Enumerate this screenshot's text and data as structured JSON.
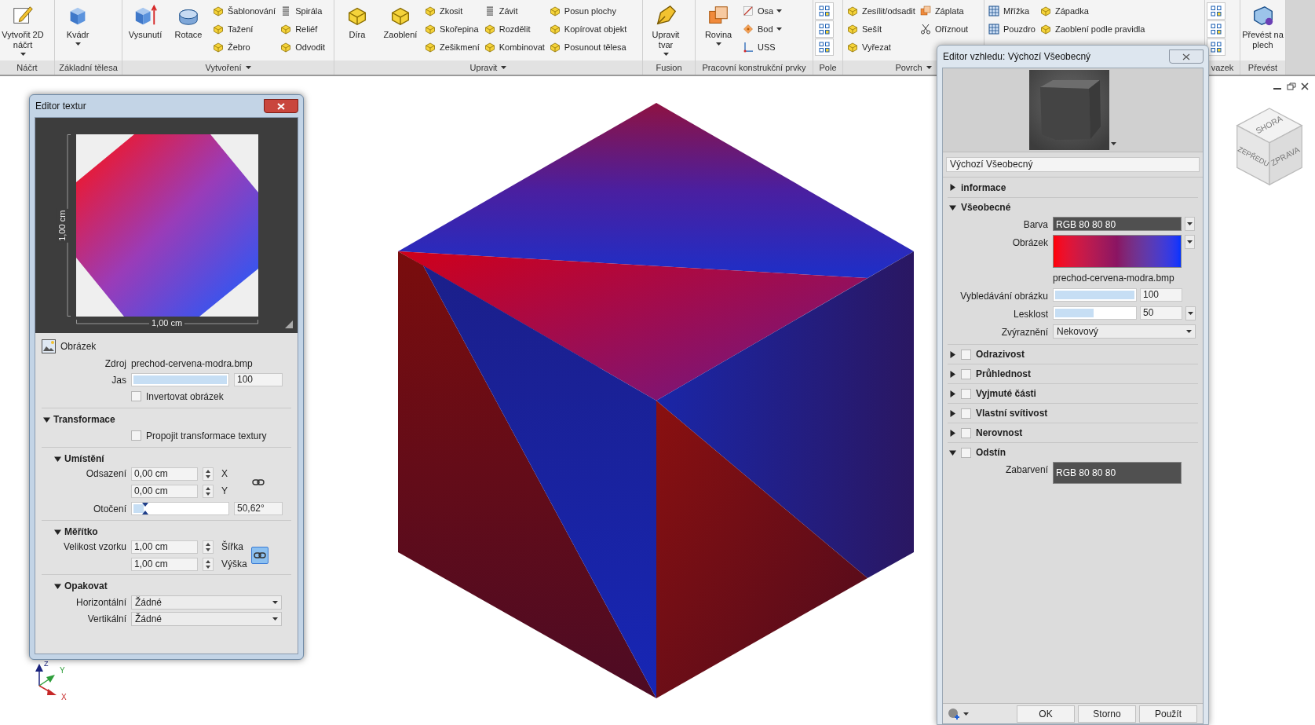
{
  "ribbon": {
    "groups": [
      {
        "label": "Náčrt",
        "menu": false,
        "columns": [
          {
            "kind": "large",
            "label": "Vytvořit 2D náčrt",
            "dropdown": true
          }
        ]
      },
      {
        "label": "Základní tělesa",
        "menu": false,
        "columns": [
          {
            "kind": "large",
            "label": "Kvádr",
            "dropdown": true
          }
        ]
      },
      {
        "label": "Vytvoření",
        "menu": true,
        "columns": [
          {
            "kind": "large",
            "label": "Vysunutí",
            "dropdown": false
          },
          {
            "kind": "large",
            "label": "Rotace",
            "dropdown": false
          },
          {
            "kind": "small",
            "items": [
              {
                "label": "Šablonování",
                "dropdown": false
              },
              {
                "label": "Tažení",
                "dropdown": false
              },
              {
                "label": "Žebro",
                "dropdown": false
              }
            ]
          },
          {
            "kind": "small",
            "items": [
              {
                "label": "Spirála",
                "dropdown": false
              },
              {
                "label": "Reliéf",
                "dropdown": false
              },
              {
                "label": "Odvodit",
                "dropdown": false
              }
            ]
          }
        ]
      },
      {
        "label": "Upravit",
        "menu": true,
        "columns": [
          {
            "kind": "large",
            "label": "Díra",
            "dropdown": false
          },
          {
            "kind": "large",
            "label": "Zaoblení",
            "dropdown": false
          },
          {
            "kind": "small",
            "items": [
              {
                "label": "Zkosit",
                "dropdown": false
              },
              {
                "label": "Skořepina",
                "dropdown": false
              },
              {
                "label": "Zešikmení",
                "dropdown": false
              }
            ]
          },
          {
            "kind": "small",
            "items": [
              {
                "label": "Závit",
                "dropdown": false
              },
              {
                "label": "Rozdělit",
                "dropdown": false
              },
              {
                "label": "Kombinovat",
                "dropdown": false
              }
            ]
          },
          {
            "kind": "small",
            "items": [
              {
                "label": "Posun plochy",
                "dropdown": false
              },
              {
                "label": "Kopírovat objekt",
                "dropdown": false
              },
              {
                "label": "Posunout tělesa",
                "dropdown": false
              }
            ]
          }
        ]
      },
      {
        "label": "Fusion",
        "menu": false,
        "columns": [
          {
            "kind": "large",
            "label": "Upravit tvar",
            "dropdown": true
          }
        ]
      },
      {
        "label": "Pracovní konstrukční prvky",
        "menu": false,
        "columns": [
          {
            "kind": "large",
            "label": "Rovina",
            "dropdown": true
          },
          {
            "kind": "small",
            "items": [
              {
                "label": "Osa",
                "dropdown": true
              },
              {
                "label": "Bod",
                "dropdown": true
              },
              {
                "label": "USS",
                "dropdown": false
              }
            ]
          }
        ]
      },
      {
        "label": "Pole",
        "menu": false,
        "columns": [
          {
            "kind": "icons"
          }
        ]
      },
      {
        "label": "Povrch",
        "menu": true,
        "columns": [
          {
            "kind": "small",
            "items": [
              {
                "label": "Zesílit/odsadit",
                "dropdown": false
              },
              {
                "label": "Sešít",
                "dropdown": false
              },
              {
                "label": "Vyřezat",
                "dropdown": false
              }
            ]
          },
          {
            "kind": "small",
            "items": [
              {
                "label": "Záplata",
                "dropdown": false
              },
              {
                "label": "Oříznout",
                "dropdown": false
              }
            ]
          }
        ]
      },
      {
        "columns": [
          {
            "kind": "small",
            "items": [
              {
                "label": "Mřížka",
                "dropdown": false
              },
              {
                "label": "Pouzdro",
                "dropdown": false
              }
            ]
          },
          {
            "kind": "small",
            "items": [
              {
                "label": "Západka",
                "dropdown": false
              },
              {
                "label": "Zaoblení podle pravidla",
                "dropdown": false
              }
            ]
          }
        ]
      },
      {
        "label": "vazek",
        "menu": false,
        "columns": [
          {
            "kind": "icons"
          }
        ]
      },
      {
        "label": "Převést",
        "menu": false,
        "columns": [
          {
            "kind": "large",
            "label": "Převést na plech",
            "dropdown": false
          }
        ]
      }
    ]
  },
  "texture_editor": {
    "title": "Editor textur",
    "preview": {
      "height_label": "1,00 cm",
      "width_label": "1,00 cm"
    },
    "image": {
      "heading": "Obrázek",
      "source_label": "Zdroj",
      "source": "prechod-cervena-modra.bmp",
      "brightness": {
        "label": "Jas",
        "level": 1,
        "value": "100"
      },
      "invert": {
        "label": "Invertovat obrázek",
        "checked": false
      }
    },
    "transform": {
      "heading": "Transformace",
      "expanded": true,
      "link": {
        "label": "Propojit transformace textury",
        "checked": false
      }
    },
    "placement": {
      "heading": "Umístění",
      "expanded": true,
      "offset_label": "Odsazení",
      "offset_x": "0,00 cm",
      "x_label": "X",
      "offset_y": "0,00 cm",
      "y_label": "Y",
      "linked": false,
      "rotation_label": "Otočení",
      "rotation": {
        "level": 0.14,
        "value": "50,62°"
      }
    },
    "scale": {
      "heading": "Měřítko",
      "expanded": true,
      "size_label": "Velikost vzorku",
      "width": "1,00 cm",
      "width_label": "Šířka",
      "height": "1,00 cm",
      "height_label": "Výška",
      "linked": true
    },
    "repeat": {
      "heading": "Opakovat",
      "expanded": true,
      "rows": [
        {
          "label": "Horizontální",
          "value": "Žádné"
        },
        {
          "label": "Vertikální",
          "value": "Žádné"
        }
      ]
    }
  },
  "appearance_editor": {
    "title": "Editor vzhledu: Výchozí Všeobecný",
    "name": "Výchozí Všeobecný",
    "sections": [
      {
        "title": "informace",
        "kind": "plain",
        "expanded": false
      },
      {
        "title": "Všeobecné",
        "kind": "plain",
        "expanded": true,
        "rows": [
          {
            "kind": "color",
            "label": "Barva",
            "value": "RGB 80 80 80",
            "dropdown": true
          },
          {
            "kind": "image",
            "label": "Obrázek",
            "caption": "prechod-cervena-modra.bmp",
            "dropdown": true
          },
          {
            "kind": "slider",
            "label": "Vybledávání obrázku",
            "level": 1,
            "value": "100",
            "dropdown": false
          },
          {
            "kind": "slider",
            "label": "Lesklost",
            "level": 0.5,
            "value": "50",
            "dropdown": true
          },
          {
            "kind": "select",
            "label": "Zvýraznění",
            "value": "Nekovový"
          }
        ]
      },
      {
        "title": "Odrazivost",
        "kind": "toggle",
        "checked": false,
        "expanded": false
      },
      {
        "title": "Průhlednost",
        "kind": "toggle",
        "checked": false,
        "expanded": false
      },
      {
        "title": "Vyjmuté části",
        "kind": "toggle",
        "checked": false,
        "expanded": false
      },
      {
        "title": "Vlastní svítivost",
        "kind": "toggle",
        "checked": false,
        "expanded": false
      },
      {
        "title": "Nerovnost",
        "kind": "toggle",
        "checked": false,
        "expanded": false
      },
      {
        "title": "Odstín",
        "kind": "toggle",
        "checked": false,
        "expanded": true,
        "rows": [
          {
            "kind": "color",
            "label": "Zabarvení",
            "value": "RGB 80 80 80",
            "dropdown": false
          }
        ]
      }
    ],
    "buttons": [
      "OK",
      "Storno",
      "Použít"
    ]
  },
  "viewport": {
    "view_cube_labels": [
      "SHORA",
      "ZEPŘEDU",
      "ZPRAVA"
    ],
    "axis_labels": [
      "Z",
      "Y",
      "X"
    ]
  }
}
